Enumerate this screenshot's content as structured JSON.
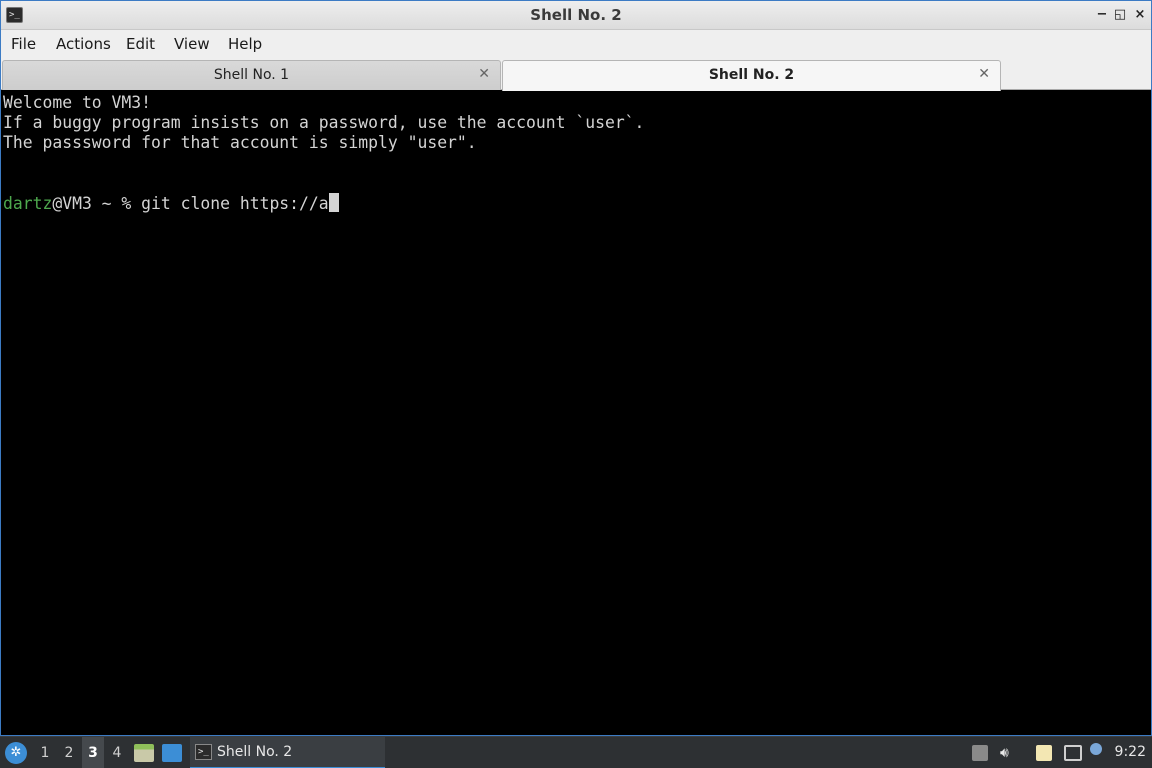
{
  "window": {
    "title": "Shell No. 2",
    "controls": {
      "minimize": "−",
      "maximize": "◱",
      "close": "×"
    }
  },
  "menu": {
    "items": [
      "File",
      "Actions",
      "Edit",
      "View",
      "Help"
    ]
  },
  "tabs": [
    {
      "label": "Shell No. 1",
      "active": false
    },
    {
      "label": "Shell No. 2",
      "active": true
    }
  ],
  "terminal": {
    "lines": [
      "Welcome to VM3!",
      "If a buggy program insists on a password, use the account `user`.",
      "The passsword for that account is simply \"user\"."
    ],
    "prompt": {
      "user": "dartz",
      "host_and_path": "@VM3 ~ % ",
      "command": "git clone https://a"
    }
  },
  "taskbar": {
    "workspaces": [
      "1",
      "2",
      "3",
      "4"
    ],
    "active_workspace": "3",
    "task_label": "Shell No. 2",
    "clock": "9:22"
  },
  "colors": {
    "accent": "#3c8ed6",
    "prompt_user": "#4ea94e",
    "terminal_bg": "#000000"
  }
}
